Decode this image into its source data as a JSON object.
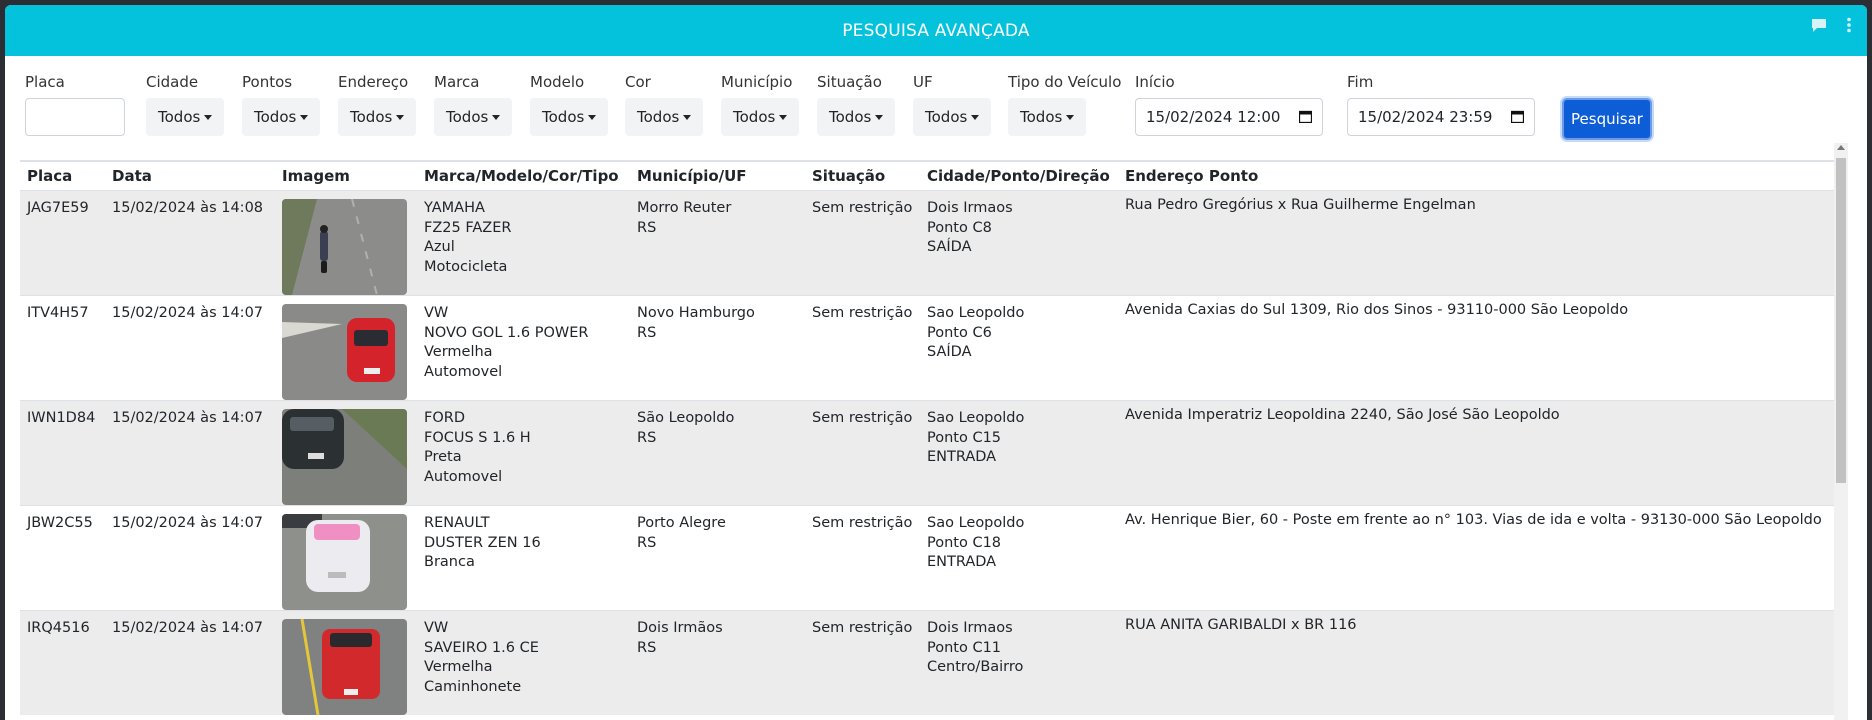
{
  "header": {
    "title": "PESQUISA AVANÇADA"
  },
  "filters": {
    "placa": {
      "label": "Placa",
      "value": ""
    },
    "cidade": {
      "label": "Cidade",
      "value": "Todos"
    },
    "pontos": {
      "label": "Pontos",
      "value": "Todos"
    },
    "endereco": {
      "label": "Endereço",
      "value": "Todos"
    },
    "marca": {
      "label": "Marca",
      "value": "Todos"
    },
    "modelo": {
      "label": "Modelo",
      "value": "Todos"
    },
    "cor": {
      "label": "Cor",
      "value": "Todos"
    },
    "municipio": {
      "label": "Município",
      "value": "Todos"
    },
    "situacao": {
      "label": "Situação",
      "value": "Todos"
    },
    "uf": {
      "label": "UF",
      "value": "Todos"
    },
    "tipo": {
      "label": "Tipo do Veículo",
      "value": "Todos"
    },
    "inicio": {
      "label": "Início",
      "value": "15/02/2024 12:00"
    },
    "fim": {
      "label": "Fim",
      "value": "15/02/2024 23:59"
    },
    "search_button": "Pesquisar"
  },
  "table": {
    "headers": [
      "Placa",
      "Data",
      "Imagem",
      "Marca/Modelo/Cor/Tipo",
      "Município/UF",
      "Situação",
      "Cidade/Ponto/Direção",
      "Endereço Ponto"
    ],
    "rows": [
      {
        "placa": "JAG7E59",
        "data": "15/02/2024 às 14:08",
        "marca": "YAMAHA",
        "modelo": "FZ25 FAZER",
        "cor": "Azul",
        "tipo": "Motocicleta",
        "municipio": "Morro Reuter",
        "uf": "RS",
        "situacao": "Sem restrição",
        "cidade": "Dois Irmaos",
        "ponto": "Ponto C8",
        "direcao": "SAÍDA",
        "endereco": "Rua Pedro Gregórius x Rua Guilherme Engelman"
      },
      {
        "placa": "ITV4H57",
        "data": "15/02/2024 às 14:07",
        "marca": "VW",
        "modelo": "NOVO GOL 1.6 POWER",
        "cor": "Vermelha",
        "tipo": "Automovel",
        "municipio": "Novo Hamburgo",
        "uf": "RS",
        "situacao": "Sem restrição",
        "cidade": "Sao Leopoldo",
        "ponto": "Ponto C6",
        "direcao": "SAÍDA",
        "endereco": "Avenida Caxias do Sul 1309, Rio dos Sinos - 93110-000 São Leopoldo"
      },
      {
        "placa": "IWN1D84",
        "data": "15/02/2024 às 14:07",
        "marca": "FORD",
        "modelo": "FOCUS S 1.6 H",
        "cor": "Preta",
        "tipo": "Automovel",
        "municipio": "São Leopoldo",
        "uf": "RS",
        "situacao": "Sem restrição",
        "cidade": "Sao Leopoldo",
        "ponto": "Ponto C15",
        "direcao": "ENTRADA",
        "endereco": "Avenida Imperatriz Leopoldina 2240, São José São Leopoldo"
      },
      {
        "placa": "JBW2C55",
        "data": "15/02/2024 às 14:07",
        "marca": "RENAULT",
        "modelo": "DUSTER ZEN 16",
        "cor": "Branca",
        "tipo": "",
        "municipio": "Porto Alegre",
        "uf": "RS",
        "situacao": "Sem restrição",
        "cidade": "Sao Leopoldo",
        "ponto": "Ponto C18",
        "direcao": "ENTRADA",
        "endereco": "Av. Henrique Bier, 60 - Poste em frente ao n° 103. Vias de ida e volta - 93130-000 São Leopoldo"
      },
      {
        "placa": "IRQ4516",
        "data": "15/02/2024 às 14:07",
        "marca": "VW",
        "modelo": "SAVEIRO 1.6 CE",
        "cor": "Vermelha",
        "tipo": "Caminhonete",
        "municipio": "Dois Irmãos",
        "uf": "RS",
        "situacao": "Sem restrição",
        "cidade": "Dois Irmaos",
        "ponto": "Ponto C11",
        "direcao": "Centro/Bairro",
        "endereco": "RUA ANITA GARIBALDI x BR 116"
      }
    ]
  }
}
